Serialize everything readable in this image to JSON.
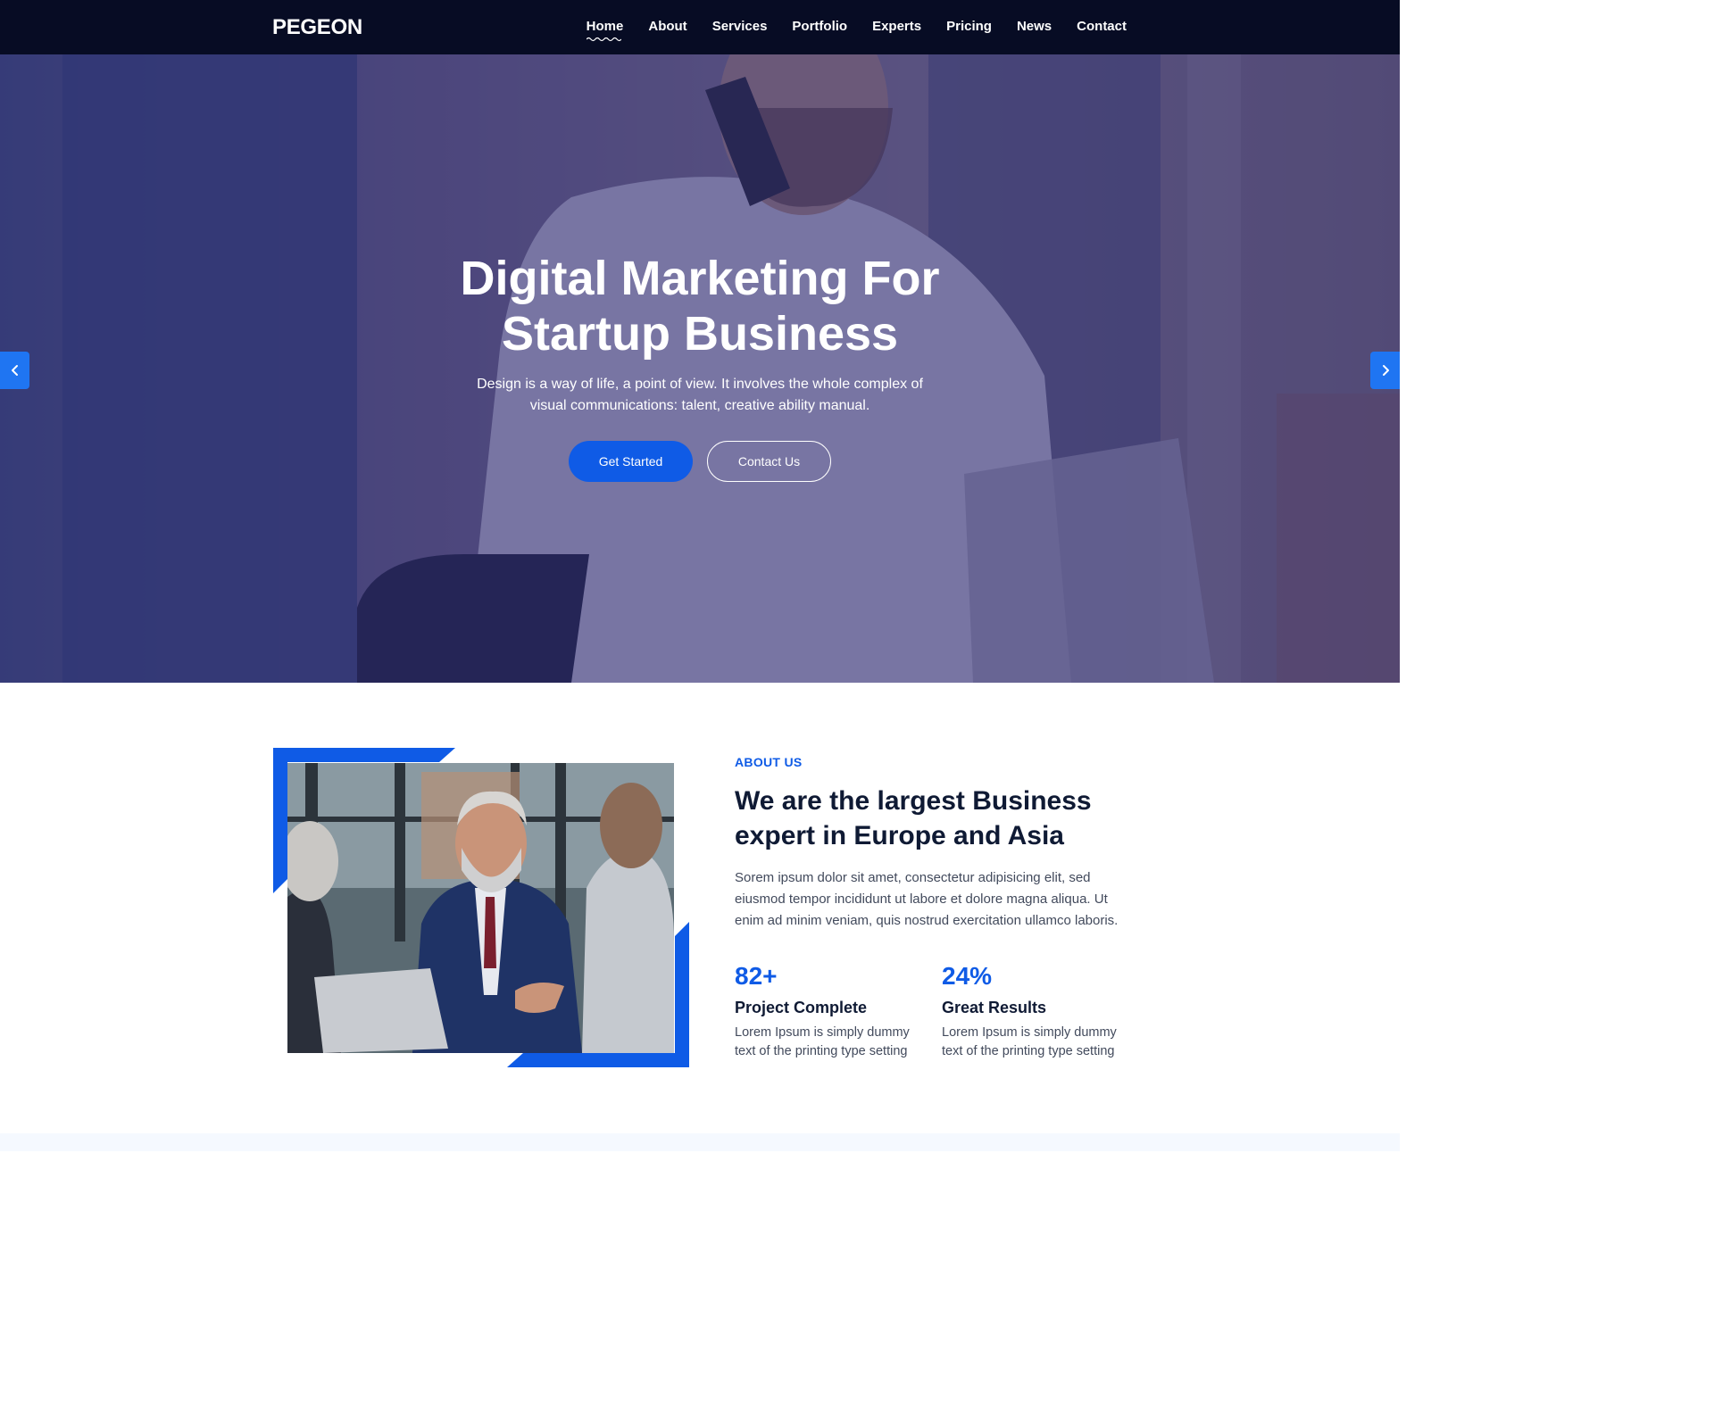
{
  "brand": {
    "logo": "PEGEON"
  },
  "nav": {
    "items": [
      {
        "label": "Home",
        "active": true
      },
      {
        "label": "About"
      },
      {
        "label": "Services"
      },
      {
        "label": "Portfolio"
      },
      {
        "label": "Experts"
      },
      {
        "label": "Pricing"
      },
      {
        "label": "News"
      },
      {
        "label": "Contact"
      }
    ]
  },
  "hero": {
    "title_line1": "Digital Marketing For",
    "title_line2": "Startup Business",
    "subtitle": "Design is a way of life, a point of view. It involves the whole complex of visual communications: talent, creative ability manual.",
    "primary_button": "Get Started",
    "secondary_button": "Contact Us",
    "prev_icon": "chevron-left-icon",
    "next_icon": "chevron-right-icon"
  },
  "about": {
    "label": "ABOUT US",
    "title": "We are the largest Business expert in Europe and Asia",
    "text": "Sorem ipsum dolor sit amet, consectetur adipisicing elit, sed eiusmod tempor incididunt ut labore et dolore magna aliqua. Ut enim ad minim veniam, quis nostrud exercitation ullamco laboris.",
    "stats": [
      {
        "number": "82+",
        "title": "Project Complete",
        "text": "Lorem Ipsum is simply dummy text of the printing type setting"
      },
      {
        "number": "24%",
        "title": "Great Results",
        "text": "Lorem Ipsum is simply dummy text of the printing type setting"
      }
    ]
  },
  "colors": {
    "nav_bg": "#070c24",
    "accent": "#0f5be6",
    "arrow_bg": "#1f75f2",
    "heading": "#0f1a34"
  }
}
